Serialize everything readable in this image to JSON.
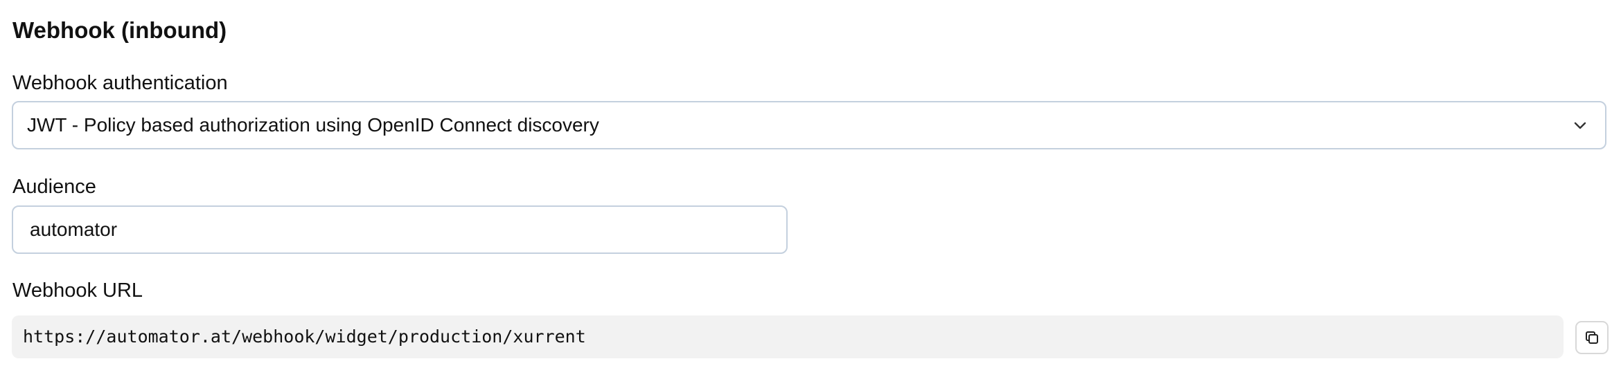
{
  "section": {
    "title": "Webhook (inbound)"
  },
  "authentication": {
    "label": "Webhook authentication",
    "selected_value": "JWT - Policy based authorization using OpenID Connect discovery",
    "icon": "chevron-down-icon"
  },
  "audience": {
    "label": "Audience",
    "value": "automator"
  },
  "webhook_url": {
    "label": "Webhook URL",
    "value": "https://automator.at/webhook/widget/production/xurrent",
    "copy_icon": "copy-icon"
  },
  "colors": {
    "border": "#c4d0de",
    "url_background": "#f2f2f2",
    "text": "#111111"
  }
}
